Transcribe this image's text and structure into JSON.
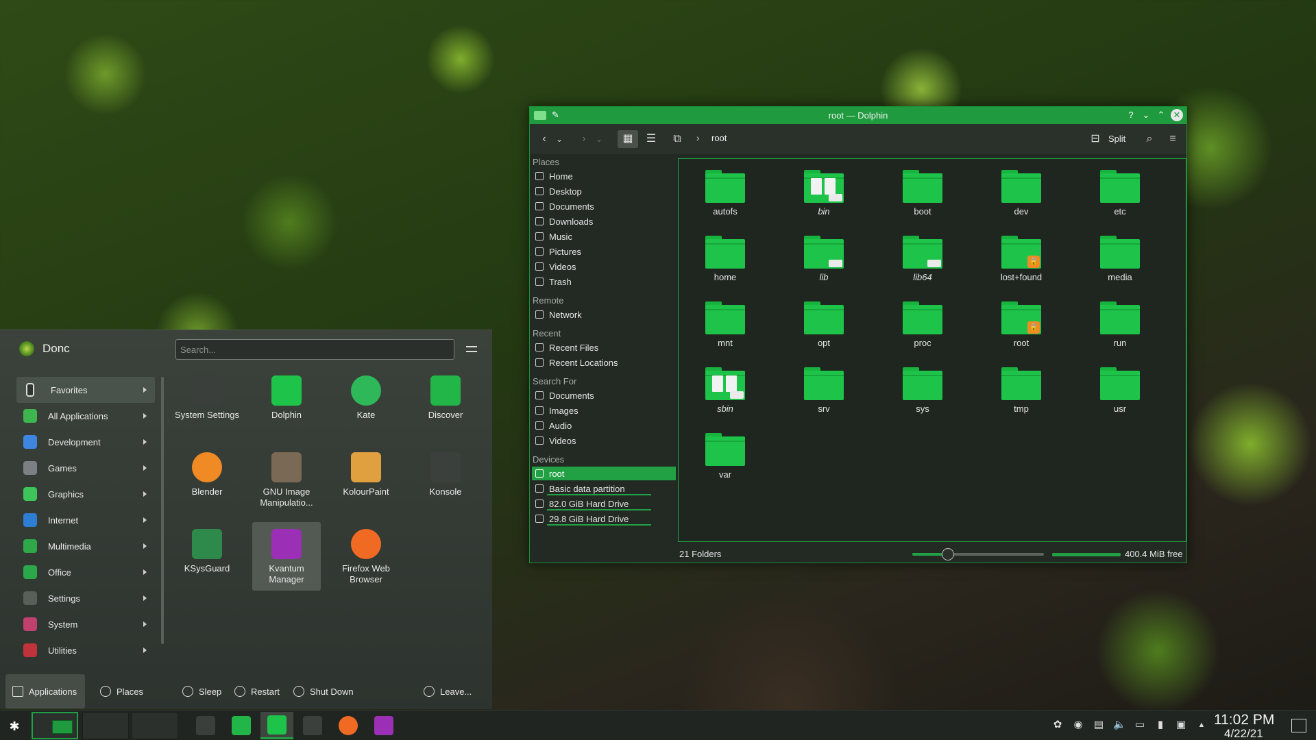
{
  "launcher": {
    "user_name": "Donc",
    "search_placeholder": "Search...",
    "categories": [
      {
        "label": "Favorites",
        "color": "#2f3530"
      },
      {
        "label": "All Applications",
        "color": "#3fb54f"
      },
      {
        "label": "Development",
        "color": "#3f86e0"
      },
      {
        "label": "Games",
        "color": "#7c7f84"
      },
      {
        "label": "Graphics",
        "color": "#3ec45a"
      },
      {
        "label": "Internet",
        "color": "#2d7dd2"
      },
      {
        "label": "Multimedia",
        "color": "#2fa84a"
      },
      {
        "label": "Office",
        "color": "#2ca84b"
      },
      {
        "label": "Settings",
        "color": "#596059"
      },
      {
        "label": "System",
        "color": "#c04070"
      },
      {
        "label": "Utilities",
        "color": "#c0333b"
      }
    ],
    "apps": [
      {
        "label": "System Settings",
        "icon": "system-settings-icon",
        "color": "#3a3f3b"
      },
      {
        "label": "Dolphin",
        "icon": "dolphin-icon",
        "color": "#1ec44a"
      },
      {
        "label": "Kate",
        "icon": "kate-icon",
        "color": "#2fb85a"
      },
      {
        "label": "Discover",
        "icon": "discover-icon",
        "color": "#22b547"
      },
      {
        "label": "Blender",
        "icon": "blender-icon",
        "color": "#f08a24"
      },
      {
        "label": "GNU Image Manipulatio...",
        "icon": "gimp-icon",
        "color": "#7a6a55"
      },
      {
        "label": "KolourPaint",
        "icon": "kolourpaint-icon",
        "color": "#e0a040"
      },
      {
        "label": "Konsole",
        "icon": "konsole-icon",
        "color": "#3b403c"
      },
      {
        "label": "KSysGuard",
        "icon": "ksysguard-icon",
        "color": "#2d8a4a"
      },
      {
        "label": "Kvantum Manager",
        "icon": "kvantum-icon",
        "color": "#9b2fb5"
      },
      {
        "label": "Firefox Web Browser",
        "icon": "firefox-icon",
        "color": "#f06a24"
      }
    ],
    "footer": {
      "applications": "Applications",
      "places": "Places",
      "sleep": "Sleep",
      "restart": "Restart",
      "shutdown": "Shut Down",
      "leave": "Leave..."
    }
  },
  "dolphin": {
    "title": "root — Dolphin",
    "breadcrumb": "root",
    "split_label": "Split",
    "help_glyph": "?",
    "sections": {
      "places": "Places",
      "remote": "Remote",
      "recent": "Recent",
      "search_for": "Search For",
      "devices": "Devices"
    },
    "places": [
      "Home",
      "Desktop",
      "Documents",
      "Downloads",
      "Music",
      "Pictures",
      "Videos",
      "Trash"
    ],
    "remote": [
      "Network"
    ],
    "recent": [
      "Recent Files",
      "Recent Locations"
    ],
    "search_for": [
      "Documents",
      "Images",
      "Audio",
      "Videos"
    ],
    "devices": [
      {
        "label": "root",
        "usage": 0
      },
      {
        "label": "Basic data partition",
        "usage": 1
      },
      {
        "label": "82.0 GiB Hard Drive",
        "usage": 1
      },
      {
        "label": "29.8 GiB Hard Drive",
        "usage": 1
      }
    ],
    "folders": [
      {
        "name": "autofs",
        "italic": false,
        "badge": ""
      },
      {
        "name": "bin",
        "italic": true,
        "badge": "link-docs"
      },
      {
        "name": "boot",
        "italic": false,
        "badge": ""
      },
      {
        "name": "dev",
        "italic": false,
        "badge": ""
      },
      {
        "name": "etc",
        "italic": false,
        "badge": ""
      },
      {
        "name": "home",
        "italic": false,
        "badge": ""
      },
      {
        "name": "lib",
        "italic": true,
        "badge": "link"
      },
      {
        "name": "lib64",
        "italic": true,
        "badge": "link"
      },
      {
        "name": "lost+found",
        "italic": false,
        "badge": "lock"
      },
      {
        "name": "media",
        "italic": false,
        "badge": ""
      },
      {
        "name": "mnt",
        "italic": false,
        "badge": ""
      },
      {
        "name": "opt",
        "italic": false,
        "badge": ""
      },
      {
        "name": "proc",
        "italic": false,
        "badge": ""
      },
      {
        "name": "root",
        "italic": false,
        "badge": "lock"
      },
      {
        "name": "run",
        "italic": false,
        "badge": ""
      },
      {
        "name": "sbin",
        "italic": true,
        "badge": "link-docs"
      },
      {
        "name": "srv",
        "italic": false,
        "badge": ""
      },
      {
        "name": "sys",
        "italic": false,
        "badge": ""
      },
      {
        "name": "tmp",
        "italic": false,
        "badge": ""
      },
      {
        "name": "usr",
        "italic": false,
        "badge": ""
      },
      {
        "name": "var",
        "italic": false,
        "badge": ""
      }
    ],
    "status": "21 Folders",
    "free_space": "400.4 MiB free",
    "zoom_level": 0.27,
    "accent": "#22a144"
  },
  "panel": {
    "clock_time": "11:02 PM",
    "clock_date": "4/22/21",
    "tasks": [
      {
        "icon": "system-settings-icon",
        "color": "#3a3f3b",
        "active": false
      },
      {
        "icon": "discover-icon",
        "color": "#22b547",
        "active": false
      },
      {
        "icon": "dolphin-icon",
        "color": "#1ec44a",
        "active": true
      },
      {
        "icon": "konsole-icon",
        "color": "#3b403c",
        "active": false
      },
      {
        "icon": "firefox-icon",
        "color": "#f06a24",
        "active": false
      },
      {
        "icon": "kvantum-icon",
        "color": "#9b2fb5",
        "active": false
      }
    ],
    "tray": [
      "activities-icon",
      "vault-icon",
      "clipboard-icon",
      "volume-icon",
      "display-icon",
      "battery-icon",
      "network-icon",
      "expand-arrow-icon"
    ]
  }
}
